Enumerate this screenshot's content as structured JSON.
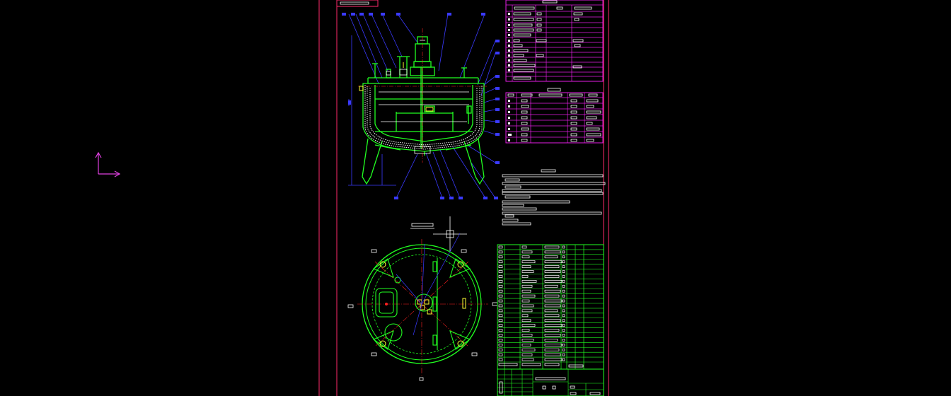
{
  "app": {
    "title": "",
    "canvas_background": "#000000"
  },
  "ucs": {
    "icon": "ucs-axis-icon",
    "x_label": "",
    "y_label": "",
    "color": "#e040e0"
  },
  "drawing": {
    "colors": {
      "frame": "#ff2a6d",
      "outline": "#ffffff",
      "green": "#21ff21",
      "blue": "#3a3aff",
      "red": "#ff2020",
      "magenta_table": "#e61ee6",
      "yellow": "#ffff33"
    },
    "views": [
      "front-section-view",
      "top-plan-view"
    ],
    "tables": [
      "nozzle-table-top",
      "technical-data-table",
      "technical-requirements-text",
      "parts-list-table",
      "title-block"
    ]
  },
  "status": ""
}
